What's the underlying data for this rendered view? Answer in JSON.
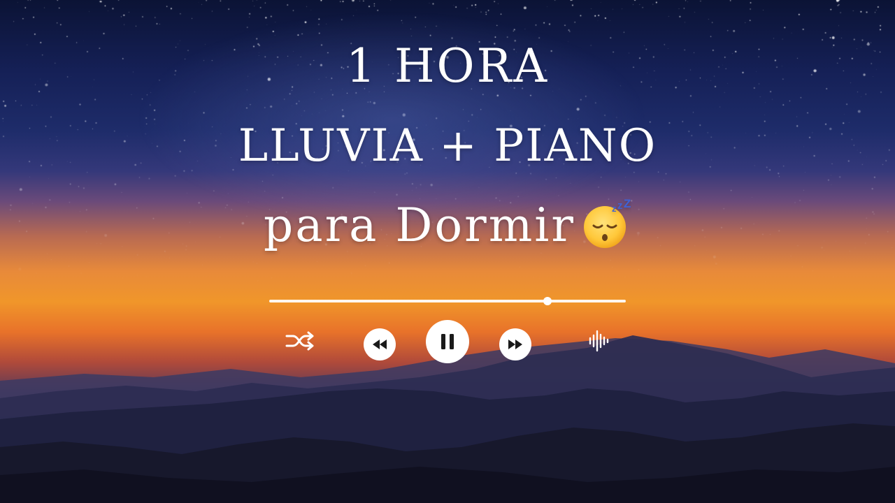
{
  "video": {
    "title_line1": "1 HORA",
    "title_line2": "LLUVIA + PIANO",
    "title_line3": "para Dormir",
    "emoji": "sleeping-face",
    "text_color": "#ffffff"
  },
  "player": {
    "progress_fraction": 0.78,
    "state": "playing",
    "controls": {
      "shuffle": "shuffle-icon",
      "rewind": "rewind-icon",
      "play_pause": "pause-icon",
      "forward": "fast-forward-icon",
      "soundwave": "soundwave-icon"
    }
  }
}
